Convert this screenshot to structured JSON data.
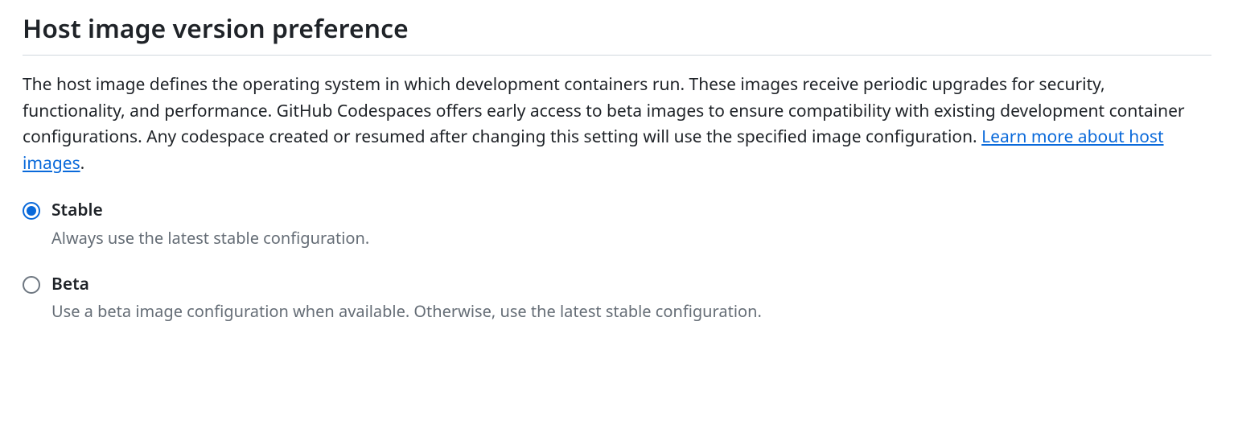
{
  "section": {
    "title": "Host image version preference",
    "description": "The host image defines the operating system in which development containers run. These images receive periodic upgrades for security, functionality, and performance. GitHub Codespaces offers early access to beta images to ensure compatibility with existing development container configurations. Any codespace created or resumed after changing this setting will use the specified image configuration. ",
    "link_text": "Learn more about host images",
    "link_trailing": "."
  },
  "options": {
    "stable": {
      "label": "Stable",
      "description": "Always use the latest stable configuration.",
      "selected": true
    },
    "beta": {
      "label": "Beta",
      "description": "Use a beta image configuration when available. Otherwise, use the latest stable configuration.",
      "selected": false
    }
  }
}
